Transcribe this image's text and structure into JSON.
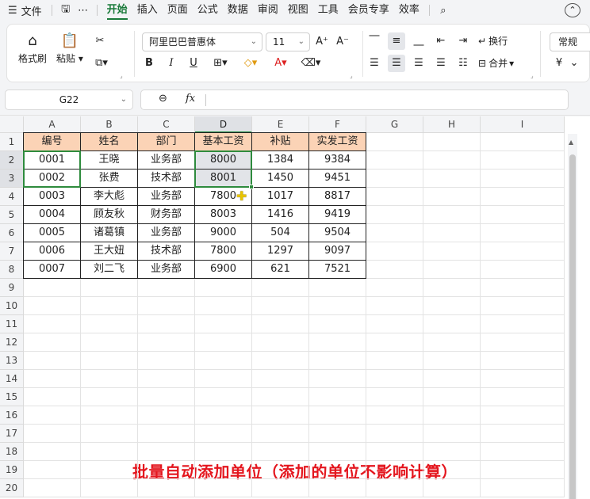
{
  "menubar": {
    "file_label": "文件",
    "tabs": [
      {
        "label": "开始",
        "active": true
      },
      {
        "label": "插入",
        "active": false
      },
      {
        "label": "页面",
        "active": false
      },
      {
        "label": "公式",
        "active": false
      },
      {
        "label": "数据",
        "active": false
      },
      {
        "label": "审阅",
        "active": false
      },
      {
        "label": "视图",
        "active": false
      },
      {
        "label": "工具",
        "active": false
      },
      {
        "label": "会员专享",
        "active": false
      },
      {
        "label": "效率",
        "active": false
      }
    ]
  },
  "ribbon": {
    "format_painter_label": "格式刷",
    "paste_label": "粘贴",
    "font_name": "阿里巴巴普惠体",
    "font_size": "11",
    "wrap_label": "换行",
    "merge_label": "合并",
    "number_format": "常规",
    "currency_symbol": "¥"
  },
  "formula_bar": {
    "cell_ref": "G22",
    "fx_label": "fx",
    "formula": ""
  },
  "sheet": {
    "columns": [
      "A",
      "B",
      "C",
      "D",
      "E",
      "F",
      "G",
      "H",
      "I"
    ],
    "selected_column": "D",
    "rows": [
      "1",
      "2",
      "3",
      "4",
      "5",
      "6",
      "7",
      "8",
      "9",
      "10",
      "11",
      "12",
      "13",
      "14",
      "15",
      "16",
      "17",
      "18",
      "19",
      "20"
    ],
    "selected_rows": [
      "2",
      "3"
    ],
    "table": {
      "headers": [
        "编号",
        "姓名",
        "部门",
        "基本工资",
        "补贴",
        "实发工资"
      ],
      "rows": [
        [
          "0001",
          "王晓",
          "业务部",
          "8000",
          "1384",
          "9384"
        ],
        [
          "0002",
          "张费",
          "技术部",
          "8001",
          "1450",
          "9451"
        ],
        [
          "0003",
          "李大彪",
          "业务部",
          "7800",
          "1017",
          "8817"
        ],
        [
          "0004",
          "顾友秋",
          "财务部",
          "8003",
          "1416",
          "9419"
        ],
        [
          "0005",
          "诸葛镇",
          "业务部",
          "9000",
          "504",
          "9504"
        ],
        [
          "0006",
          "王大妞",
          "技术部",
          "7800",
          "1297",
          "9097"
        ],
        [
          "0007",
          "刘二飞",
          "业务部",
          "6900",
          "621",
          "7521"
        ]
      ]
    },
    "header_fill_color": "#fbd3b6",
    "selection_color": "#2e8b3d"
  },
  "caption": "批量自动添加单位（添加的单位不影响计算）"
}
